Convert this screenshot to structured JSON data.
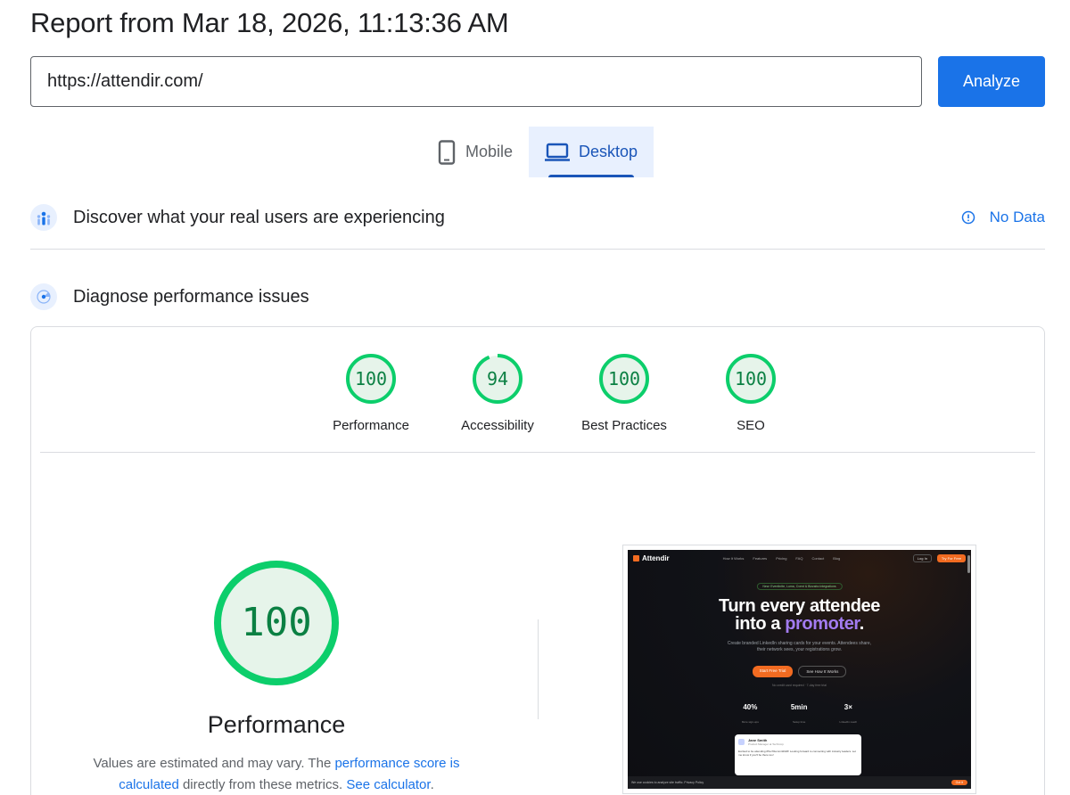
{
  "report": {
    "title": "Report from Mar 18, 2026, 11:13:36 AM"
  },
  "search": {
    "url_value": "https://attendir.com/",
    "analyze_label": "Analyze"
  },
  "tabs": [
    {
      "label": "Mobile",
      "icon": "phone-icon"
    },
    {
      "label": "Desktop",
      "icon": "laptop-icon",
      "selected": true
    }
  ],
  "crux": {
    "title": "Discover what your real users are experiencing",
    "status": "No Data",
    "icon": "users-chart-icon"
  },
  "diagnose": {
    "title": "Diagnose performance issues",
    "icon": "lighthouse-icon"
  },
  "scores": [
    {
      "label": "Performance",
      "score": "100",
      "value": 100
    },
    {
      "label": "Accessibility",
      "score": "94",
      "value": 94
    },
    {
      "label": "Best Practices",
      "score": "100",
      "value": 100
    },
    {
      "label": "SEO",
      "score": "100",
      "value": 100
    }
  ],
  "performance": {
    "score": "100",
    "value": 100,
    "label": "Performance",
    "desc_prefix": "Values are estimated and may vary. The ",
    "desc_link1": "performance score is calculated",
    "desc_middle": " directly from these metrics. ",
    "desc_link2": "See calculator",
    "desc_suffix": "."
  },
  "colors": {
    "pass": "#0cce6b",
    "pass_fill": "#e6f4ea",
    "pass_text": "#0b8043",
    "link": "#1a73e8",
    "accent": "#1a55b8"
  },
  "screenshot": {
    "brand": "Attendir",
    "nav_links": [
      "How It Works",
      "Features",
      "Pricing",
      "FAQ",
      "Contact",
      "Blog"
    ],
    "login": "Log In",
    "try": "Try For Free",
    "pill": "New: Eventbrite, Luma, Cvent & Bizzabo integrations",
    "headline_line1": "Turn every attendee",
    "headline_line2_a": "into a ",
    "headline_line2_accent": "promoter",
    "headline_line2_b": ".",
    "sub_line1": "Create branded LinkedIn sharing cards for your events. Attendees share,",
    "sub_line2": "their network sees, your registrations grow.",
    "cta1": "Start Free Trial",
    "cta2": "See How It Works",
    "note": "No credit card required · 7-day free trial",
    "stats": [
      {
        "value": "40%",
        "label": "More sign-ups"
      },
      {
        "value": "5min",
        "label": "Setup time"
      },
      {
        "value": "3×",
        "label": "LinkedIn reach"
      }
    ],
    "post_name": "Jane Smith",
    "post_role": "Product Manager at TechCorp",
    "post_text": "Excited to be attending #TechSummit2026! Looking forward to connecting with industry leaders. Let me know if you'll be there too!",
    "cookie": "We use cookies to analyze site traffic. Privacy Policy",
    "cookie_btn": "Got it"
  }
}
